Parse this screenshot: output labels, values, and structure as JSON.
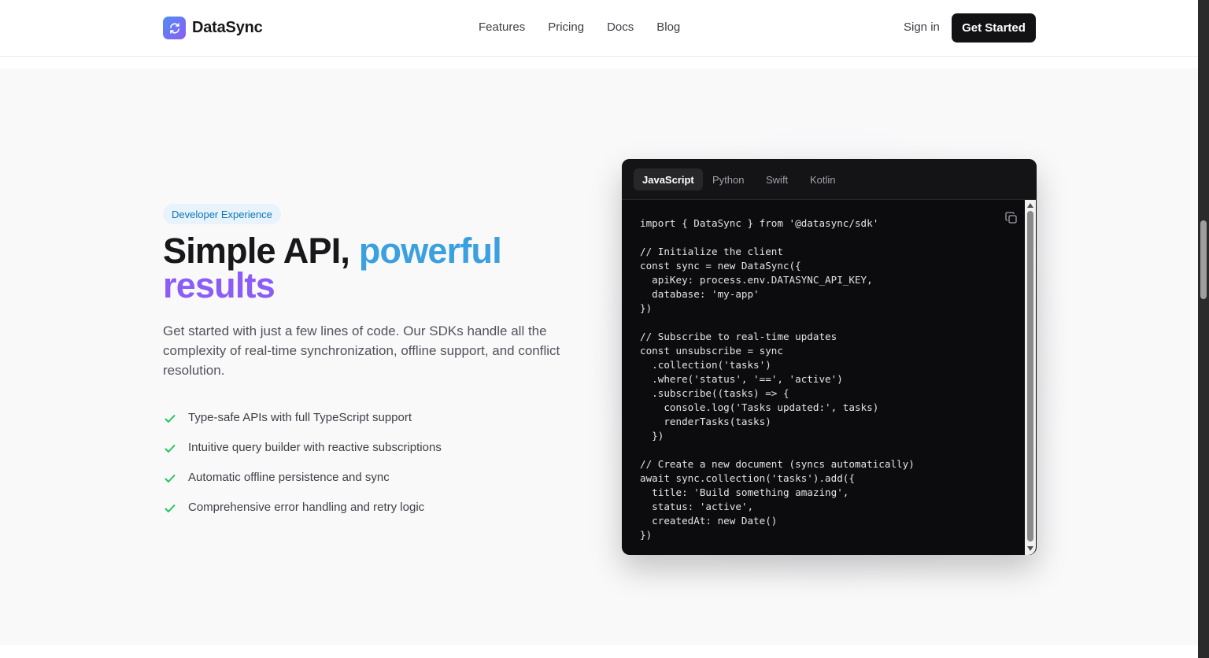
{
  "header": {
    "brand": "DataSync",
    "nav": [
      "Features",
      "Pricing",
      "Docs",
      "Blog"
    ],
    "sign_in": "Sign in",
    "cta": "Get Started"
  },
  "hero": {
    "badge": "Developer Experience",
    "headline_part1": "Simple API, ",
    "headline_part2": "powerful",
    "headline_part3": "results",
    "description": "Get started with just a few lines of code. Our SDKs handle all the complexity of real-time synchronization, offline support, and conflict resolution.",
    "features": [
      "Type-safe APIs with full TypeScript support",
      "Intuitive query builder with reactive subscriptions",
      "Automatic offline persistence and sync",
      "Comprehensive error handling and retry logic"
    ]
  },
  "code_panel": {
    "tabs": [
      "JavaScript",
      "Python",
      "Swift",
      "Kotlin"
    ],
    "active_tab": "JavaScript",
    "code": "import { DataSync } from '@datasync/sdk'\n\n// Initialize the client\nconst sync = new DataSync({\n  apiKey: process.env.DATASYNC_API_KEY,\n  database: 'my-app'\n})\n\n// Subscribe to real-time updates\nconst unsubscribe = sync\n  .collection('tasks')\n  .where('status', '==', 'active')\n  .subscribe((tasks) => {\n    console.log('Tasks updated:', tasks)\n    renderTasks(tasks)\n  })\n\n// Create a new document (syncs automatically)\nawait sync.collection('tasks').add({\n  title: 'Build something amazing',\n  status: 'active',\n  createdAt: new Date()\n})"
  },
  "colors": {
    "accent_blue": "#3aa0e0",
    "accent_purple": "#8b5cf6",
    "check_green": "#22c55e",
    "cta_bg": "#121214"
  },
  "icons": {
    "logo": "sync-arrows-icon",
    "feature_bullet": "check-icon",
    "copy": "copy-icon"
  }
}
